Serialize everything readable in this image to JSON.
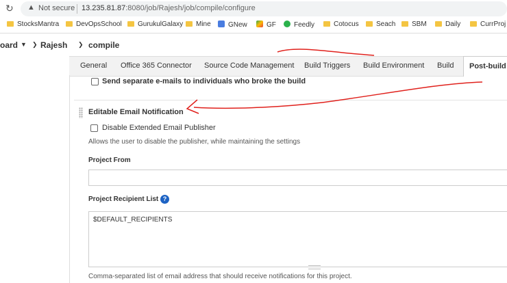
{
  "address_bar": {
    "security_text": "Not secure",
    "url_host": "13.235.81.87",
    "url_path": ":8080/job/Rajesh/job/compile/configure"
  },
  "bookmarks": [
    {
      "label": "StocksMantra",
      "icon": "folder-icon"
    },
    {
      "label": "DevOpsSchool",
      "icon": "folder-icon"
    },
    {
      "label": "GurukulGalaxy",
      "icon": "folder-icon"
    },
    {
      "label": "Mine",
      "icon": "folder-icon"
    },
    {
      "label": "GNew",
      "icon": "gnews-icon"
    },
    {
      "label": "GF",
      "icon": "gf-icon"
    },
    {
      "label": "Feedly",
      "icon": "feedly-icon"
    },
    {
      "label": "Cotocus",
      "icon": "folder-icon"
    },
    {
      "label": "Seach",
      "icon": "folder-icon"
    },
    {
      "label": "SBM",
      "icon": "folder-icon"
    },
    {
      "label": "Daily",
      "icon": "folder-icon"
    },
    {
      "label": "CurrProj",
      "icon": "folder-icon"
    }
  ],
  "breadcrumb": {
    "items": [
      "oard",
      "Rajesh",
      "compile"
    ]
  },
  "tabs": [
    {
      "label": "General"
    },
    {
      "label": "Office 365 Connector"
    },
    {
      "label": "Source Code Management"
    },
    {
      "label": "Build Triggers"
    },
    {
      "label": "Build Environment"
    },
    {
      "label": "Build"
    },
    {
      "label": "Post-build A"
    }
  ],
  "form": {
    "send_separate_label": "Send separate e-mails to individuals who broke the build",
    "section_title": "Editable Email Notification",
    "disable_label": "Disable Extended Email Publisher",
    "disable_desc": "Allows the user to disable the publisher, while maintaining the settings",
    "project_from_label": "Project From",
    "project_from_value": "",
    "recipient_label": "Project Recipient List",
    "help_glyph": "?",
    "recipient_value": "$DEFAULT_RECIPIENTS",
    "recipient_desc": "Comma-separated list of email address that should receive notifications for this project."
  },
  "colors": {
    "annotation": "#e0201b",
    "help_badge": "#1d63c4"
  }
}
